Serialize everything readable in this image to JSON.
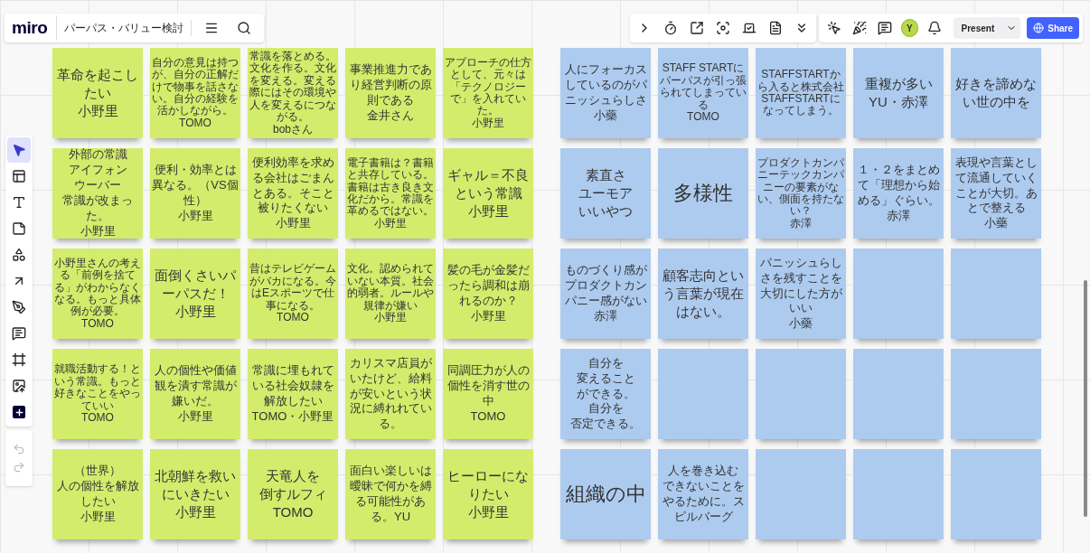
{
  "topbar": {
    "logo": "miro",
    "board_title": "パーパス・バリュー検討"
  },
  "toolbar_right": {
    "avatar": "Y",
    "present": "Present",
    "share": "Share"
  },
  "left_toolbar": {
    "tools": [
      {
        "kind": "select",
        "selected": true
      },
      {
        "kind": "templates",
        "selected": false
      },
      {
        "kind": "text",
        "selected": false
      },
      {
        "kind": "sticky",
        "selected": false
      },
      {
        "kind": "shapes",
        "selected": false
      },
      {
        "kind": "arrow",
        "selected": false
      },
      {
        "kind": "pen",
        "selected": false
      },
      {
        "kind": "comment",
        "selected": false
      },
      {
        "kind": "frame",
        "selected": false
      },
      {
        "kind": "upload",
        "selected": false
      },
      {
        "kind": "more",
        "selected": false
      }
    ]
  },
  "sections": [
    {
      "color": "#d4ec6c",
      "notes": [
        {
          "kind": "text",
          "lines": [
            "革命を起こしたい",
            "小野里"
          ]
        },
        {
          "kind": "text",
          "lines": [
            "自分の意見は持つが、自分の正解だけで物事を話さない。自分の経験を活かしながら。",
            "TOMO"
          ]
        },
        {
          "kind": "text",
          "lines": [
            "常識を落とめる。文化を作る。文化を変える。変える際にはその環境や人を変えるにつながる。",
            "bobさん"
          ]
        },
        {
          "kind": "text",
          "lines": [
            "事業推進力であり経営判断の原則である",
            "金井さん"
          ]
        },
        {
          "kind": "text",
          "lines": [
            "アプローチの仕方として、元々は「テクノロジーで」を入れていた。",
            "小野里"
          ]
        },
        {
          "kind": "text",
          "lines": [
            "外部の常識",
            "アイフォン",
            "ウーバー",
            "常識が改まった。",
            "小野里"
          ]
        },
        {
          "kind": "text",
          "lines": [
            "便利・効率とは異なる。（VS個性）",
            "小野里"
          ]
        },
        {
          "kind": "text",
          "lines": [
            "便利効率を求める会社はごまんとある。そこと被りたくない",
            "小野里"
          ]
        },
        {
          "kind": "text",
          "lines": [
            "電子書籍は？書籍と共存している。書籍は古き良き文化だから。常識を革めるではない。小野里"
          ]
        },
        {
          "kind": "text",
          "lines": [
            "ギャル＝不良という常識",
            "小野里"
          ]
        },
        {
          "kind": "text",
          "lines": [
            "小野里さんの考える「前例を捨てる」がわからなくなる。もっと具体例が必要。",
            "TOMO"
          ]
        },
        {
          "kind": "text",
          "lines": [
            "面倒くさいパーパスだ！",
            "小野里"
          ]
        },
        {
          "kind": "text",
          "lines": [
            "昔はテレビゲームがバカになる。今はEスポーツで仕事になる。",
            "TOMO"
          ]
        },
        {
          "kind": "text",
          "lines": [
            "文化。認められていない本質。社会的弱者。ルールや規律が嫌い",
            "小野里"
          ]
        },
        {
          "kind": "text",
          "lines": [
            "髪の毛が金髪だったら調和は崩れるのか？",
            "小野里"
          ]
        },
        {
          "kind": "text",
          "lines": [
            "就職活動する！という常識。もっと好きなことをやっていい",
            "TOMO"
          ]
        },
        {
          "kind": "text",
          "lines": [
            "人の個性や価値観を潰す常識が嫌いだ。",
            "小野里"
          ]
        },
        {
          "kind": "text",
          "lines": [
            "常識に埋もれている社会奴隷を解放したい",
            "TOMO・小野里"
          ]
        },
        {
          "kind": "text",
          "lines": [
            "カリスマ店員がいたけど、給料が安いという状況に縛れれている。"
          ]
        },
        {
          "kind": "text",
          "lines": [
            "同調圧力が人の個性を消す世の中",
            "TOMO"
          ]
        },
        {
          "kind": "text",
          "lines": [
            "（世界）",
            "人の個性を解放したい",
            "小野里"
          ]
        },
        {
          "kind": "text",
          "lines": [
            "北朝鮮を救いにいきたい",
            "小野里"
          ]
        },
        {
          "kind": "text",
          "lines": [
            "天竜人を",
            "倒すルフィ",
            "TOMO"
          ]
        },
        {
          "kind": "text",
          "lines": [
            "面白い楽しいは曖昧で何かを縛る可能性がある。YU"
          ]
        },
        {
          "kind": "text",
          "lines": [
            "ヒーローになりたい",
            "小野里"
          ]
        }
      ]
    },
    {
      "color": "#adcbef",
      "notes": [
        {
          "kind": "text",
          "lines": [
            "人にフォーカスしているのがパニッシュらしさ",
            "小藥"
          ]
        },
        {
          "kind": "text",
          "lines": [
            "STAFF STARTにパーパスが引っ張られてしまっている",
            "TOMO"
          ]
        },
        {
          "kind": "text",
          "lines": [
            "STAFFSTARTから入ると株式会社STAFFSTARTになってしまう。"
          ]
        },
        {
          "kind": "text",
          "lines": [
            "重複が多い",
            "YU・赤澤"
          ]
        },
        {
          "kind": "text",
          "lines": [
            "好きを諦めない世の中を"
          ]
        },
        {
          "kind": "text",
          "lines": [
            "素直さ",
            "ユーモア",
            "いいやつ"
          ]
        },
        {
          "kind": "text",
          "lines": [
            "多様性"
          ]
        },
        {
          "kind": "text",
          "lines": [
            "プロダクトカンパニーテックカンパニーの要素がない、側面を持たない？",
            "赤澤"
          ]
        },
        {
          "kind": "text",
          "lines": [
            "１・２をまとめて「理想から始める」ぐらい。",
            "赤澤"
          ]
        },
        {
          "kind": "text",
          "lines": [
            "表現や言葉として流通していくことが大切。あとで整える",
            "小藥"
          ]
        },
        {
          "kind": "text",
          "lines": [
            "ものづくり感がプロダクトカンパニー感がない",
            "赤澤"
          ]
        },
        {
          "kind": "text",
          "lines": [
            "顧客志向という言葉が現在はない。"
          ]
        },
        {
          "kind": "text",
          "lines": [
            "パニッシュらしさを残すことを大切にした方がいい",
            "小藥"
          ]
        },
        {
          "kind": "empty"
        },
        {
          "kind": "empty"
        },
        {
          "kind": "text",
          "lines": [
            "自分を",
            "変えること",
            "ができる。",
            "自分を",
            "否定できる。"
          ]
        },
        {
          "kind": "empty"
        },
        {
          "kind": "empty"
        },
        {
          "kind": "empty"
        },
        {
          "kind": "empty"
        },
        {
          "kind": "text",
          "lines": [
            "組織の中"
          ]
        },
        {
          "kind": "text",
          "lines": [
            "人を巻き込む",
            "できないことをやるために。スピルバーグ"
          ]
        },
        {
          "kind": "empty"
        },
        {
          "kind": "empty"
        },
        {
          "kind": "empty"
        }
      ]
    }
  ]
}
